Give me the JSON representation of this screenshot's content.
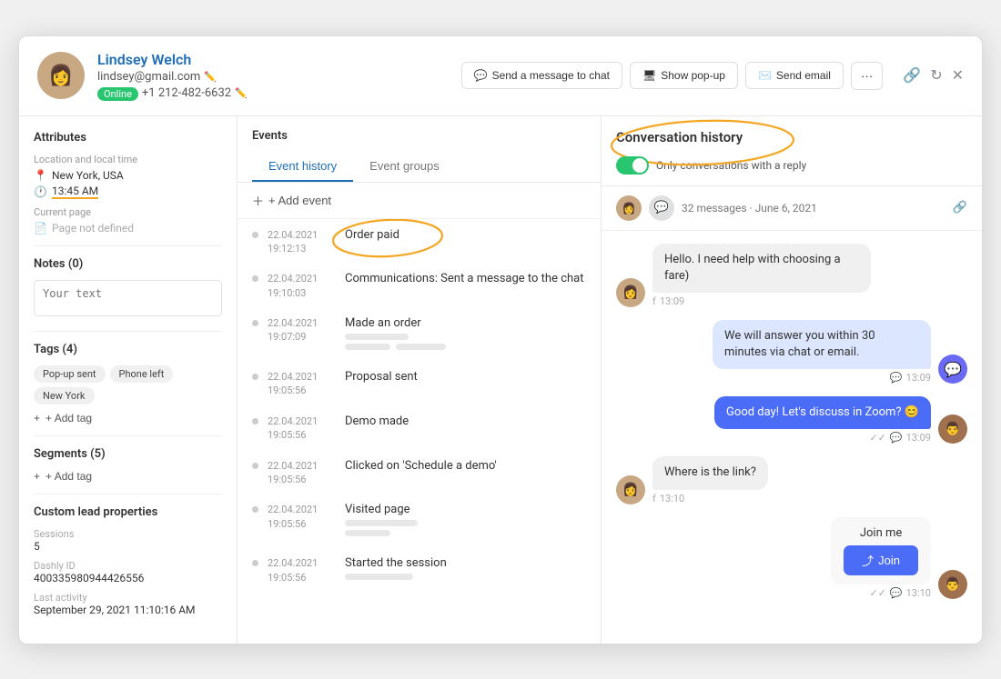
{
  "header": {
    "name": "Lindsey Welch",
    "email": "lindsey@gmail.com",
    "phone": "+1 212-482-6632",
    "status": "Online",
    "avatar_emoji": "👩",
    "actions": {
      "send_message": "Send a message to chat",
      "show_popup": "Show pop-up",
      "send_email": "Send email"
    }
  },
  "sidebar": {
    "title": "Attributes",
    "location_label": "Location and local time",
    "location": "New York, USA",
    "time": "13:45 AM",
    "current_page_label": "Current page",
    "current_page": "Page not defined",
    "notes_title": "Notes (0)",
    "notes_placeholder": "Your text",
    "tags_title": "Tags (4)",
    "tags": [
      "Pop-up sent",
      "Phone left",
      "New York"
    ],
    "add_tag_label": "+ Add tag",
    "segments_title": "Segments (5)",
    "custom_props_title": "Custom lead properties",
    "sessions_label": "Sessions",
    "sessions_value": "5",
    "dashly_id_label": "Dashly ID",
    "dashly_id_value": "400335980944426556",
    "last_activity_label": "Last activity",
    "last_activity_value": "September 29, 2021 11:10:16 AM"
  },
  "events": {
    "title": "Events",
    "tabs": [
      "Event history",
      "Event groups"
    ],
    "add_event_label": "+ Add event",
    "items": [
      {
        "date": "22.04.2021",
        "time": "19:12:13",
        "name": "Order paid",
        "circled": true,
        "has_bars": false
      },
      {
        "date": "22.04.2021",
        "time": "19:10:03",
        "name": "Communications: Sent a message to the chat",
        "circled": false,
        "has_bars": false
      },
      {
        "date": "22.04.2021",
        "time": "19:07:09",
        "name": "Made an order",
        "circled": false,
        "has_bars": true
      },
      {
        "date": "22.04.2021",
        "time": "19:05:56",
        "name": "Proposal sent",
        "circled": false,
        "has_bars": false
      },
      {
        "date": "22.04.2021",
        "time": "19:05:56",
        "name": "Demo made",
        "circled": false,
        "has_bars": false
      },
      {
        "date": "22.04.2021",
        "time": "19:05:56",
        "name": "Clicked on 'Schedule a demo'",
        "circled": false,
        "has_bars": false
      },
      {
        "date": "22.04.2021",
        "time": "19:05:56",
        "name": "Visited page",
        "circled": false,
        "has_bars": true
      },
      {
        "date": "22.04.2021",
        "time": "19:05:56",
        "name": "Started the session",
        "circled": false,
        "has_bars": true
      }
    ]
  },
  "conversation": {
    "title": "Conversation history",
    "toggle_label": "Only conversations with a reply",
    "meta": "32 messages · June 6, 2021",
    "messages": [
      {
        "id": 1,
        "side": "left",
        "text": "Hello. I need help with choosing a fare)",
        "time": "13:09",
        "source": "f",
        "avatar": "👩"
      },
      {
        "id": 2,
        "side": "right",
        "text": "We will answer you within 30 minutes via chat or email.",
        "time": "13:09",
        "source": "chat",
        "avatar": "💬"
      },
      {
        "id": 3,
        "side": "right",
        "text": "Good day! Let's discuss in Zoom? 😊",
        "time": "13:09",
        "source": "chat",
        "avatar_brown": true
      },
      {
        "id": 4,
        "side": "left",
        "text": "Where is the link?",
        "time": "13:10",
        "source": "f",
        "avatar": "👩"
      },
      {
        "id": 5,
        "side": "right_card",
        "title": "Join me",
        "btn_label": "Join",
        "time": "13:10",
        "source": "chat",
        "avatar_brown": true
      }
    ]
  }
}
